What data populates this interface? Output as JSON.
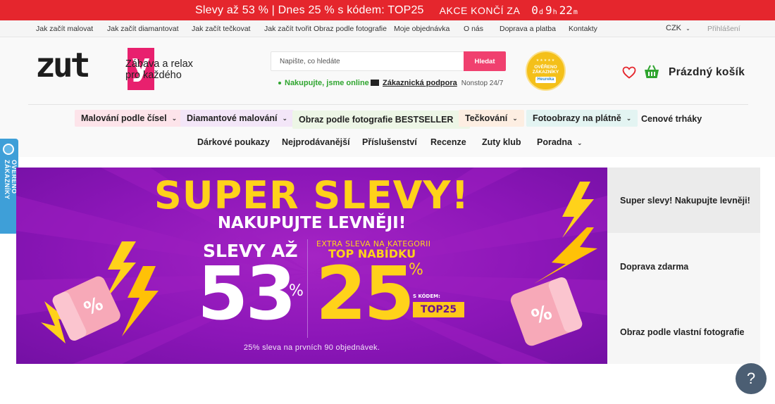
{
  "promo": {
    "main": "Slevy až 53 % | Dnes 25 % s kódem: TOP25",
    "ends_label": "AKCE KONČÍ ZA",
    "countdown": {
      "days": "0",
      "days_unit": "d",
      "hours": "9",
      "hours_unit": "h",
      "minutes": "22",
      "minutes_unit": "m"
    }
  },
  "topnav": {
    "links": [
      "Jak začít malovat",
      "Jak začít diamantovat",
      "Jak začít tečkovat",
      "Jak začít tvořit Obraz podle fotografie",
      "Moje objednávka",
      "O nás",
      "Doprava a platba",
      "Kontakty"
    ],
    "currency": "CZK",
    "login": "Přihlášení"
  },
  "header": {
    "logo_text": "zuty",
    "tagline_line1": "Zábava a relax",
    "tagline_line2": "pro každého",
    "search_placeholder": "Napište, co hledáte",
    "search_button": "Hledat",
    "online_status": "Nakupujte, jsme online",
    "support_link": "Zákaznická podpora",
    "support_hours": "Nonstop 24/7",
    "badge_line1": "OVĚŘENO",
    "badge_line2": "ZÁKAZNÍKY",
    "badge_brand": "Heureka",
    "cart_label": "Prázdný košík"
  },
  "catnav": {
    "row1": [
      {
        "label": "Malování podle čísel",
        "dropdown": true,
        "bg": "#fde4ea"
      },
      {
        "label": "Diamantové malování",
        "dropdown": true,
        "bg": "#f3e6f8"
      },
      {
        "label": "Obraz podle fotografie BESTSELLER",
        "dropdown": true,
        "bg": "#edf6e6"
      },
      {
        "label": "Tečkování",
        "dropdown": true,
        "bg": "#fdeee2"
      },
      {
        "label": "Fotoobrazy na plátně",
        "dropdown": true,
        "bg": "#e3f4f2"
      },
      {
        "label": "Cenové trháky",
        "dropdown": false,
        "bg": ""
      }
    ],
    "row2": [
      {
        "label": "Dárkové poukazy",
        "dropdown": false
      },
      {
        "label": "Nejprodávanější",
        "dropdown": false
      },
      {
        "label": "Příslušenství",
        "dropdown": false
      },
      {
        "label": "Recenze",
        "dropdown": false
      },
      {
        "label": "Zuty klub",
        "dropdown": false
      },
      {
        "label": "Poradna",
        "dropdown": true
      }
    ]
  },
  "sidetab": {
    "label": "OVĚŘENO ZÁKAZNÍKY"
  },
  "banner": {
    "title": "SUPER SLEVY!",
    "subtitle": "NAKUPUJTE LEVNĚJI!",
    "left_label": "SLEVY AŽ",
    "left_value": "53",
    "percent": "%",
    "extra_label": "EXTRA SLEVA NA KATEGORII",
    "extra_category": "TOP NABÍDKU",
    "right_value": "25",
    "code_label": "S KÓDEM:",
    "code": "TOP25",
    "note": "25% sleva na prvních 90 objednávek."
  },
  "slides": [
    {
      "label": "Super slevy! Nakupujte levněji!",
      "active": true
    },
    {
      "label": "Doprava zdarma",
      "active": false
    },
    {
      "label": "Obraz podle vlastní fotografie",
      "active": false
    }
  ],
  "help": {
    "label": "?"
  },
  "colors": {
    "brand_pink": "#e8206e",
    "promo_red": "#e5262d",
    "online_green": "#2fa52f",
    "banner_purple": "#8c16b8",
    "banner_yellow": "#ffd21a"
  }
}
